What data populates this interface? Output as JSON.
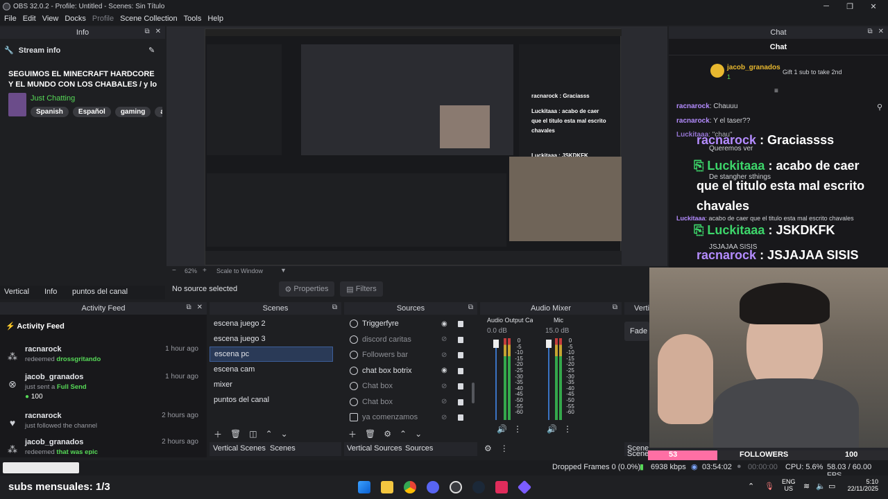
{
  "window": {
    "title": "OBS 32.0.2 - Profile: Untitled - Scenes: Sin Título"
  },
  "menu": [
    "File",
    "Edit",
    "View",
    "Docks",
    "Profile",
    "Scene Collection",
    "Tools",
    "Help"
  ],
  "info_dock": {
    "header": "Info",
    "stream_info_label": "Stream info",
    "title": "SEGUIMOS EL MINECRAFT HARDCORE Y EL MUNDO CON LOS CHABALES / y lo q...",
    "category": "Just Chatting",
    "tags": [
      "Spanish",
      "Español",
      "gaming",
      "arger"
    ]
  },
  "preview": {
    "zoom": "62%",
    "scale_mode": "Scale to Window"
  },
  "left_tabs": [
    "Vertical",
    "Info",
    "puntos del canal"
  ],
  "source_toolbar": {
    "no_source": "No source selected",
    "properties": "Properties",
    "filters": "Filters"
  },
  "activity_feed": {
    "header": "Activity Feed",
    "title": "Activity Feed",
    "items": [
      {
        "name": "racnarock",
        "action": "redeemed",
        "highlight": "drossgritando",
        "time": "1 hour ago",
        "extra": ""
      },
      {
        "name": "jacob_granados",
        "action": "just sent a",
        "highlight": "Full Send",
        "time": "1 hour ago",
        "extra": "100"
      },
      {
        "name": "racnarock",
        "action": "just followed the channel",
        "highlight": "",
        "time": "2 hours ago",
        "extra": ""
      },
      {
        "name": "jacob_granados",
        "action": "redeemed",
        "highlight": "that was epic",
        "time": "2 hours ago",
        "extra": ""
      }
    ]
  },
  "scenes": {
    "header": "Scenes",
    "items": [
      "escena juego 2",
      "escena juego 3",
      "escena pc",
      "escena cam",
      "mixer",
      "puntos del canal"
    ],
    "selected": "escena pc",
    "tabs": [
      "Vertical Scenes",
      "Scenes"
    ]
  },
  "sources": {
    "header": "Sources",
    "items": [
      {
        "name": "Triggerfyre",
        "visible": true
      },
      {
        "name": "discord caritas",
        "visible": false
      },
      {
        "name": "Followers bar",
        "visible": false
      },
      {
        "name": "chat box botrix",
        "visible": true
      },
      {
        "name": "Chat box",
        "visible": false
      },
      {
        "name": "Chat box",
        "visible": false
      },
      {
        "name": "ya comenzamos",
        "visible": false
      }
    ],
    "tabs": [
      "Vertical Sources",
      "Sources"
    ]
  },
  "audio_mixer": {
    "header": "Audio Mixer",
    "channels": [
      {
        "name": "Audio Output Ca",
        "db": "0.0 dB"
      },
      {
        "name": "Mic",
        "db": "15.0 dB"
      }
    ],
    "scale": [
      "0",
      "-5",
      "-10",
      "-15",
      "-20",
      "-25",
      "-30",
      "-35",
      "-40",
      "-45",
      "-50",
      "-55",
      "-60"
    ]
  },
  "transitions": {
    "header": "Verti",
    "fade": "Fade",
    "tabs": [
      "Scene Tran",
      "Vertical Scene Tran"
    ]
  },
  "chat_dock": {
    "header": "Chat",
    "title": "Chat",
    "pinned_user": "jacob_granados",
    "pinned_count": "1",
    "gift_text": "Gift 1 sub to take 2nd",
    "small_lines": [
      {
        "user": "racnarock",
        "text": "Chauuu"
      },
      {
        "user": "racnarock",
        "text": "Y el taser??"
      },
      {
        "user": "Luckitaaa",
        "text": "\"chau\""
      },
      {
        "user": "",
        "text": "Queremos ver"
      },
      {
        "user": "",
        "text": "De stangher sthings"
      },
      {
        "user": "Luckitaaa",
        "text": "acabo de caer que el titulo esta mal escrito chavales"
      },
      {
        "user": "",
        "text": "JSJAJAA SISIS"
      }
    ],
    "big_lines": [
      {
        "user": "racnarock",
        "text": " : Graciassss"
      },
      {
        "user": "Luckitaaa",
        "text": " : acabo de caer"
      },
      {
        "user": "",
        "text": "que el titulo esta mal escrito"
      },
      {
        "user": "",
        "text": "chavales"
      },
      {
        "user": "Luckitaaa",
        "text": " : JSKDKFK"
      },
      {
        "user": "racnarock",
        "text": " : JSJAJAA SISIS"
      }
    ]
  },
  "overlays": {
    "followers_count": "53",
    "followers_label": "FOLLOWERS",
    "followers_goal": "100",
    "subs": "subs mensuales: 1/3"
  },
  "status_bar": {
    "dropped": "Dropped Frames 0 (0.0%)",
    "bitrate": "6938 kbps",
    "live_time": "03:54:02",
    "rec_time": "00:00:00",
    "cpu": "CPU: 5.6%",
    "fps": "58.03 / 60.00 FPS"
  },
  "taskbar": {
    "lang": "ENG",
    "region": "US",
    "time": "5:10",
    "date": "22/11/2025"
  },
  "colors": {
    "accent": "#3d5f9a",
    "green": "#56d957",
    "purple": "#b48cff",
    "pink": "#ff6fa4"
  }
}
